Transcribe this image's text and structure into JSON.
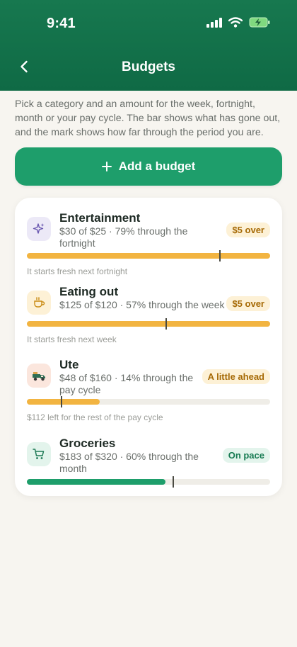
{
  "status": {
    "time": "9:41"
  },
  "header": {
    "title": "Budgets"
  },
  "intro": "Pick a category and an amount for the week, fortnight, month or your pay cycle. The bar shows what has gone out, and the mark shows how far through the period you are.",
  "add_button": {
    "label": "Add a budget"
  },
  "colors": {
    "brand": "#17784f",
    "button": "#1e9e6b",
    "over": "#f2b441",
    "onpace": "#1e9e6b"
  },
  "budgets": [
    {
      "name": "Entertainment",
      "icon": "sparkles-icon",
      "desc": "$30 of $25 · 79% through the fortnight",
      "badge": "$5 over",
      "spent_fraction": 1.0,
      "period_fraction": 0.79,
      "note": "It starts fresh next fortnight"
    },
    {
      "name": "Eating out",
      "icon": "coffee-cup-icon",
      "desc": "$125 of $120 · 57% through the week",
      "badge": "$5 over",
      "spent_fraction": 1.0,
      "period_fraction": 0.57,
      "note": "It starts fresh next week"
    },
    {
      "name": "Ute",
      "icon": "pickup-truck-icon",
      "desc": "$48 of $160 · 14% through the pay cycle",
      "badge": "A little ahead",
      "spent_fraction": 0.3,
      "period_fraction": 0.14,
      "note": "$112 left for the rest of the pay cycle"
    },
    {
      "name": "Groceries",
      "icon": "shopping-cart-icon",
      "desc": "$183 of $320 · 60% through the month",
      "badge": "On pace",
      "spent_fraction": 0.57,
      "period_fraction": 0.6
    }
  ]
}
